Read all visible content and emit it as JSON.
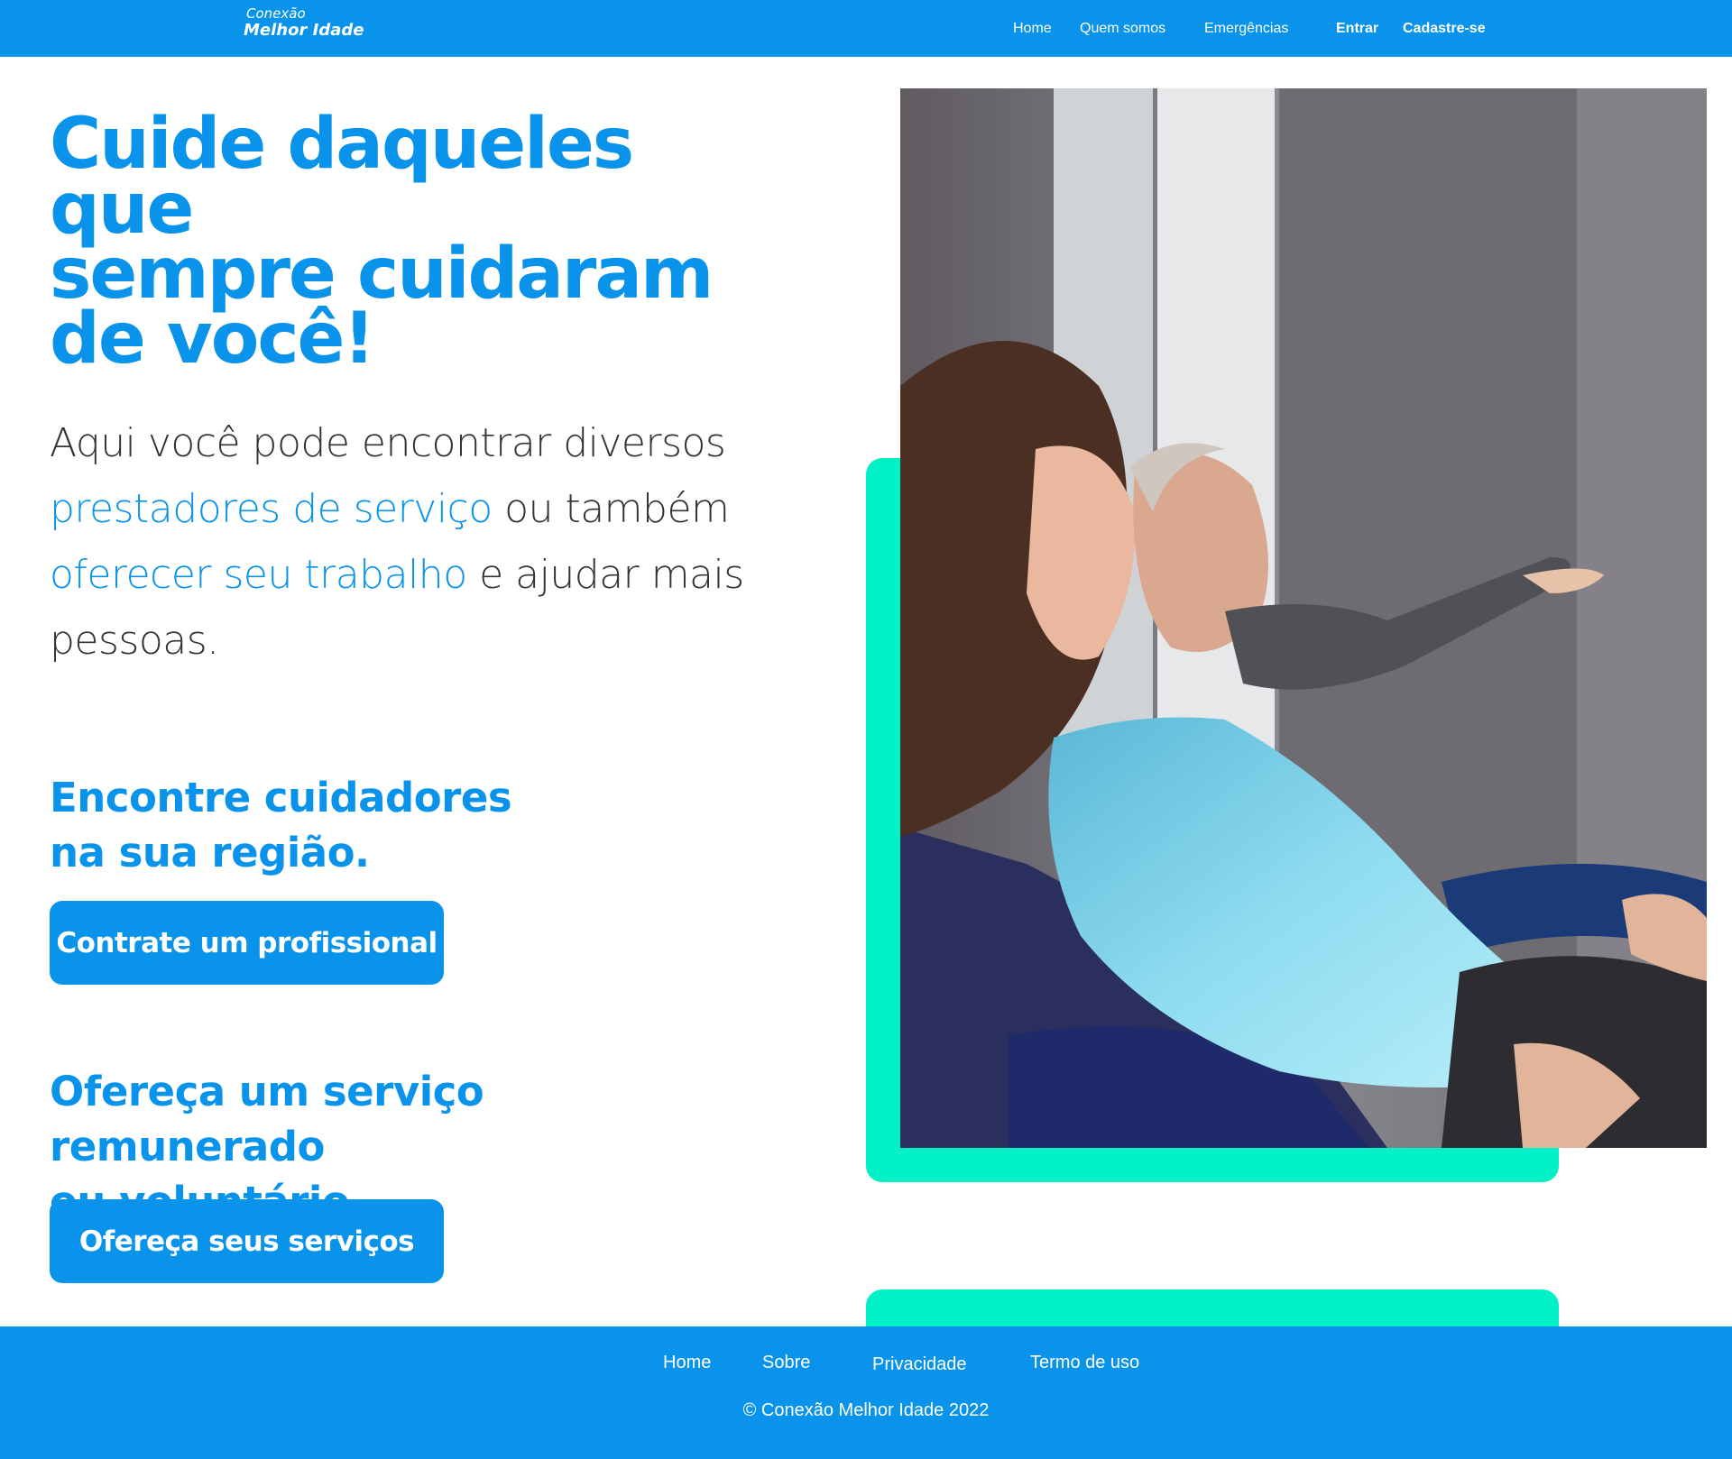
{
  "header": {
    "logo_line1": "Conexão",
    "logo_line2": "Melhor Idade",
    "nav": {
      "home": "Home",
      "about": "Quem somos",
      "emergencies": "Emergências",
      "login": "Entrar",
      "signup": "Cadastre-se"
    }
  },
  "hero": {
    "headline_lines": [
      "Cuide daqueles que",
      "sempre cuidaram",
      "de você!"
    ],
    "intro": {
      "part1": "Aqui você pode encontrar diversos ",
      "highlight1": "prestadores de serviço",
      "part2": " ou também ",
      "highlight2": "oferecer seu trabalho",
      "part3": " e ajudar mais pessoas."
    },
    "find_heading_lines": [
      "Encontre cuidadores",
      "na sua região."
    ],
    "hire_button": "Contrate um profissional",
    "offer_heading_lines": [
      "Ofereça um serviço remunerado",
      "ou voluntário."
    ],
    "offer_button": "Ofereça seus serviços"
  },
  "footer": {
    "links": {
      "home": "Home",
      "about": "Sobre",
      "privacy": "Privacidade",
      "terms": "Termo de uso"
    },
    "copyright": "© Conexão Melhor Idade 2022"
  },
  "colors": {
    "primary": "#0a93ea",
    "accent": "#00f0c8",
    "text": "#333333"
  }
}
